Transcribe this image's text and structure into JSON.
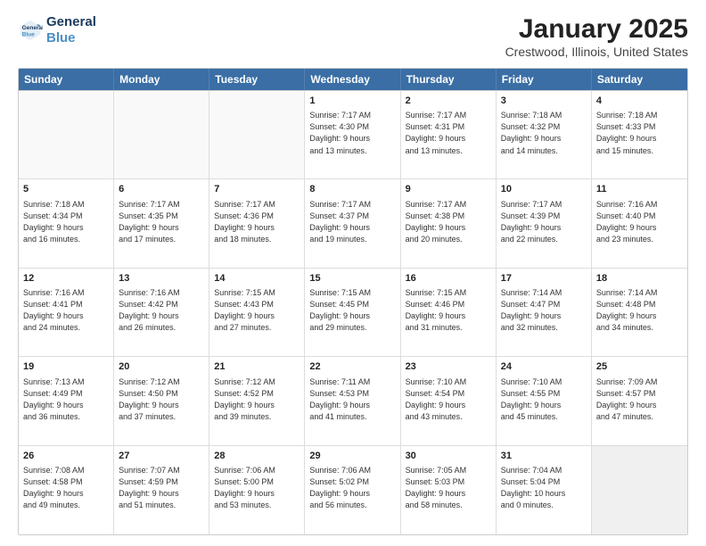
{
  "header": {
    "logo_line1": "General",
    "logo_line2": "Blue",
    "title": "January 2025",
    "subtitle": "Crestwood, Illinois, United States"
  },
  "days_of_week": [
    "Sunday",
    "Monday",
    "Tuesday",
    "Wednesday",
    "Thursday",
    "Friday",
    "Saturday"
  ],
  "weeks": [
    [
      {
        "day": "",
        "text": ""
      },
      {
        "day": "",
        "text": ""
      },
      {
        "day": "",
        "text": ""
      },
      {
        "day": "1",
        "text": "Sunrise: 7:17 AM\nSunset: 4:30 PM\nDaylight: 9 hours\nand 13 minutes."
      },
      {
        "day": "2",
        "text": "Sunrise: 7:17 AM\nSunset: 4:31 PM\nDaylight: 9 hours\nand 13 minutes."
      },
      {
        "day": "3",
        "text": "Sunrise: 7:18 AM\nSunset: 4:32 PM\nDaylight: 9 hours\nand 14 minutes."
      },
      {
        "day": "4",
        "text": "Sunrise: 7:18 AM\nSunset: 4:33 PM\nDaylight: 9 hours\nand 15 minutes."
      }
    ],
    [
      {
        "day": "5",
        "text": "Sunrise: 7:18 AM\nSunset: 4:34 PM\nDaylight: 9 hours\nand 16 minutes."
      },
      {
        "day": "6",
        "text": "Sunrise: 7:17 AM\nSunset: 4:35 PM\nDaylight: 9 hours\nand 17 minutes."
      },
      {
        "day": "7",
        "text": "Sunrise: 7:17 AM\nSunset: 4:36 PM\nDaylight: 9 hours\nand 18 minutes."
      },
      {
        "day": "8",
        "text": "Sunrise: 7:17 AM\nSunset: 4:37 PM\nDaylight: 9 hours\nand 19 minutes."
      },
      {
        "day": "9",
        "text": "Sunrise: 7:17 AM\nSunset: 4:38 PM\nDaylight: 9 hours\nand 20 minutes."
      },
      {
        "day": "10",
        "text": "Sunrise: 7:17 AM\nSunset: 4:39 PM\nDaylight: 9 hours\nand 22 minutes."
      },
      {
        "day": "11",
        "text": "Sunrise: 7:16 AM\nSunset: 4:40 PM\nDaylight: 9 hours\nand 23 minutes."
      }
    ],
    [
      {
        "day": "12",
        "text": "Sunrise: 7:16 AM\nSunset: 4:41 PM\nDaylight: 9 hours\nand 24 minutes."
      },
      {
        "day": "13",
        "text": "Sunrise: 7:16 AM\nSunset: 4:42 PM\nDaylight: 9 hours\nand 26 minutes."
      },
      {
        "day": "14",
        "text": "Sunrise: 7:15 AM\nSunset: 4:43 PM\nDaylight: 9 hours\nand 27 minutes."
      },
      {
        "day": "15",
        "text": "Sunrise: 7:15 AM\nSunset: 4:45 PM\nDaylight: 9 hours\nand 29 minutes."
      },
      {
        "day": "16",
        "text": "Sunrise: 7:15 AM\nSunset: 4:46 PM\nDaylight: 9 hours\nand 31 minutes."
      },
      {
        "day": "17",
        "text": "Sunrise: 7:14 AM\nSunset: 4:47 PM\nDaylight: 9 hours\nand 32 minutes."
      },
      {
        "day": "18",
        "text": "Sunrise: 7:14 AM\nSunset: 4:48 PM\nDaylight: 9 hours\nand 34 minutes."
      }
    ],
    [
      {
        "day": "19",
        "text": "Sunrise: 7:13 AM\nSunset: 4:49 PM\nDaylight: 9 hours\nand 36 minutes."
      },
      {
        "day": "20",
        "text": "Sunrise: 7:12 AM\nSunset: 4:50 PM\nDaylight: 9 hours\nand 37 minutes."
      },
      {
        "day": "21",
        "text": "Sunrise: 7:12 AM\nSunset: 4:52 PM\nDaylight: 9 hours\nand 39 minutes."
      },
      {
        "day": "22",
        "text": "Sunrise: 7:11 AM\nSunset: 4:53 PM\nDaylight: 9 hours\nand 41 minutes."
      },
      {
        "day": "23",
        "text": "Sunrise: 7:10 AM\nSunset: 4:54 PM\nDaylight: 9 hours\nand 43 minutes."
      },
      {
        "day": "24",
        "text": "Sunrise: 7:10 AM\nSunset: 4:55 PM\nDaylight: 9 hours\nand 45 minutes."
      },
      {
        "day": "25",
        "text": "Sunrise: 7:09 AM\nSunset: 4:57 PM\nDaylight: 9 hours\nand 47 minutes."
      }
    ],
    [
      {
        "day": "26",
        "text": "Sunrise: 7:08 AM\nSunset: 4:58 PM\nDaylight: 9 hours\nand 49 minutes."
      },
      {
        "day": "27",
        "text": "Sunrise: 7:07 AM\nSunset: 4:59 PM\nDaylight: 9 hours\nand 51 minutes."
      },
      {
        "day": "28",
        "text": "Sunrise: 7:06 AM\nSunset: 5:00 PM\nDaylight: 9 hours\nand 53 minutes."
      },
      {
        "day": "29",
        "text": "Sunrise: 7:06 AM\nSunset: 5:02 PM\nDaylight: 9 hours\nand 56 minutes."
      },
      {
        "day": "30",
        "text": "Sunrise: 7:05 AM\nSunset: 5:03 PM\nDaylight: 9 hours\nand 58 minutes."
      },
      {
        "day": "31",
        "text": "Sunrise: 7:04 AM\nSunset: 5:04 PM\nDaylight: 10 hours\nand 0 minutes."
      },
      {
        "day": "",
        "text": ""
      }
    ]
  ]
}
